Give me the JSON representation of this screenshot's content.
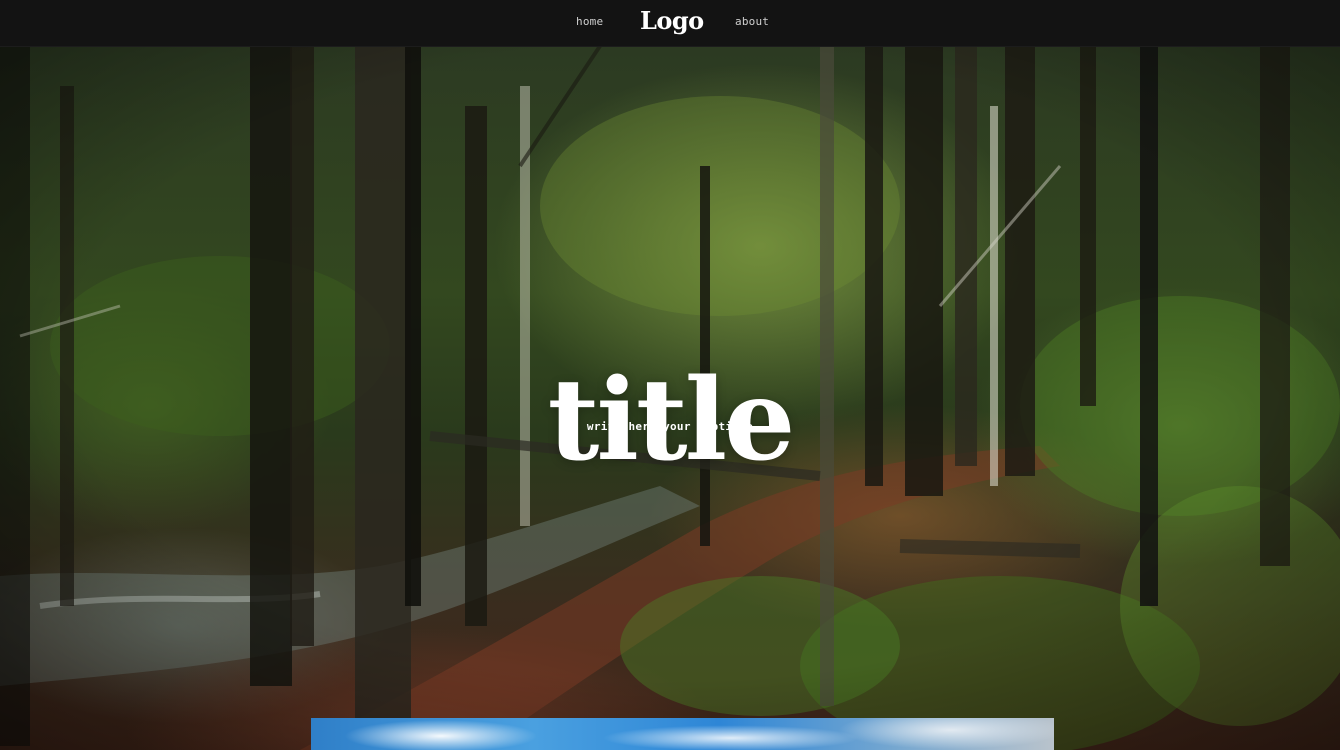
{
  "nav": {
    "home_label": "home",
    "logo_text": "Logo",
    "about_label": "about"
  },
  "hero": {
    "title": "title",
    "subtitle": "write here your subtitle"
  },
  "colors": {
    "navbar_bg": "#131313",
    "title_text": "#ffffff",
    "nav_text": "#cfcfcf"
  }
}
